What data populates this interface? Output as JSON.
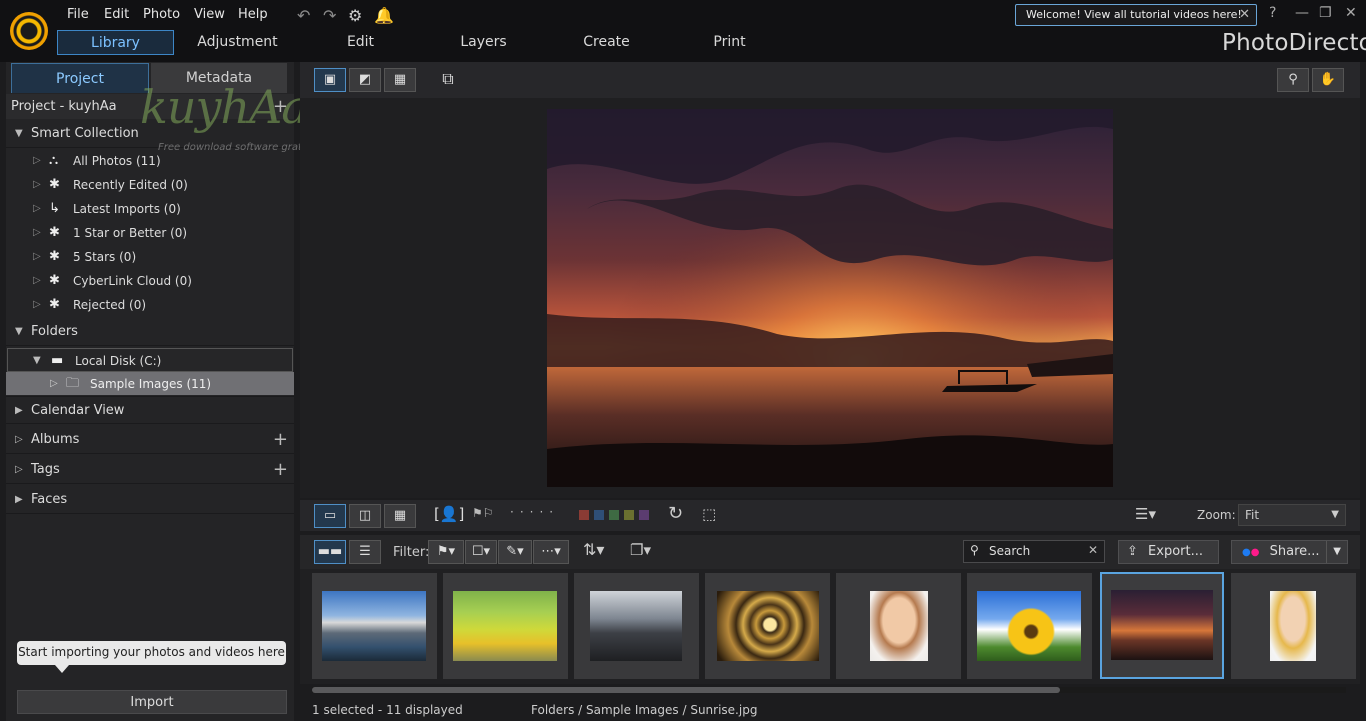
{
  "menu": [
    "File",
    "Edit",
    "Photo",
    "View",
    "Help"
  ],
  "welcome": "Welcome! View all tutorial videos here!",
  "help_label": "?",
  "mode_tabs": [
    "Library",
    "Adjustment",
    "Edit",
    "Layers",
    "Create",
    "Print"
  ],
  "app_name": "PhotoDirector",
  "left": {
    "tabs": [
      "Project",
      "Metadata"
    ],
    "project_label": "Project - kuyhAa",
    "smart_collection": {
      "title": "Smart Collection",
      "items": [
        "All Photos (11)",
        "Recently Edited (0)",
        "Latest Imports (0)",
        "1 Star or Better (0)",
        "5 Stars (0)",
        "CyberLink Cloud (0)",
        "Rejected (0)"
      ]
    },
    "folders": {
      "title": "Folders",
      "disk": "Local Disk (C:)",
      "sample": "Sample Images (11)"
    },
    "calendar": "Calendar View",
    "albums": "Albums",
    "tags": "Tags",
    "faces": "Faces",
    "watermark": "kuyhAa.Me",
    "watermark_sub": "Free download software gratis",
    "tooltip": "Start importing your photos and videos here",
    "import_button": "Import"
  },
  "toolbar2": {
    "zoom_label": "Zoom:",
    "zoom_value": "Fit"
  },
  "toolbar3": {
    "filter_label": "Filter:",
    "search_placeholder": "Search",
    "export_label": "Export...",
    "share_label": "Share..."
  },
  "status": {
    "selection": "1 selected - 11 displayed",
    "path": "Folders / Sample Images / Sunrise.jpg"
  },
  "colors": {
    "accent": "#3d86c6",
    "accent_text": "#7cc1ff",
    "color_labels": [
      "#8a3b34",
      "#2f4f77",
      "#3e6a43",
      "#6b7030",
      "#5b3c70"
    ]
  }
}
